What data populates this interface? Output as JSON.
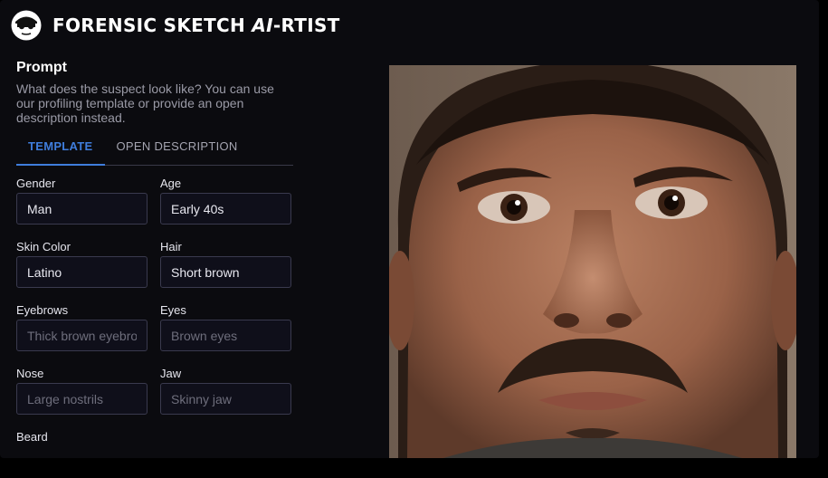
{
  "app": {
    "title_prefix": "FORENSIC SKETCH ",
    "title_ai": "AI",
    "title_suffix": "-RTIST"
  },
  "prompt": {
    "heading": "Prompt",
    "description": "What does the suspect look like? You can use our profiling template or provide an open description instead."
  },
  "tabs": [
    {
      "label": "TEMPLATE",
      "active": true
    },
    {
      "label": "OPEN DESCRIPTION",
      "active": false
    }
  ],
  "fields": {
    "gender": {
      "label": "Gender",
      "value": "Man",
      "placeholder": ""
    },
    "age": {
      "label": "Age",
      "value": "Early 40s",
      "placeholder": ""
    },
    "skin_color": {
      "label": "Skin Color",
      "value": "Latino",
      "placeholder": ""
    },
    "hair": {
      "label": "Hair",
      "value": "Short brown",
      "placeholder": ""
    },
    "eyebrows": {
      "label": "Eyebrows",
      "value": "",
      "placeholder": "Thick brown eyebrows"
    },
    "eyes": {
      "label": "Eyes",
      "value": "",
      "placeholder": "Brown eyes"
    },
    "nose": {
      "label": "Nose",
      "value": "",
      "placeholder": "Large nostrils"
    },
    "jaw": {
      "label": "Jaw",
      "value": "",
      "placeholder": "Skinny jaw"
    },
    "beard": {
      "label": "Beard"
    }
  },
  "colors": {
    "accent": "#3f7ddc",
    "background": "#0b0b0f",
    "input_background": "#0f0f1a"
  }
}
